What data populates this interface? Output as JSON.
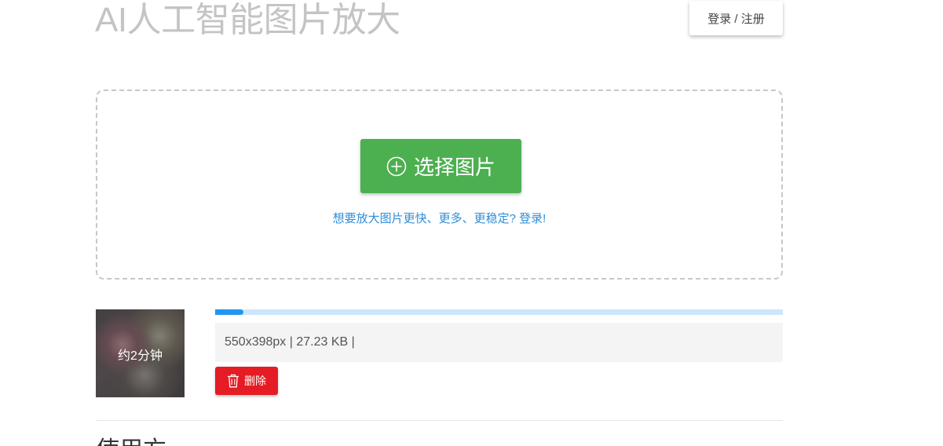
{
  "header": {
    "title": "AI人工智能图片放大",
    "login_label": "登录 / 注册"
  },
  "upload": {
    "choose_label": "选择图片",
    "login_hint": "想要放大图片更快、更多、更稳定? 登录!"
  },
  "queue": {
    "items": [
      {
        "eta": "约2分钟",
        "progress": 0.05,
        "info": "550x398px | 27.23 KB |",
        "delete_label": "删除"
      }
    ]
  },
  "section": {
    "next_heading": "使用方"
  },
  "colors": {
    "primary_green": "#4caf50",
    "danger_red": "#e51c23",
    "link_blue": "#2f8ed8",
    "progress_blue": "#2196f3",
    "progress_track": "#cde6fb"
  }
}
